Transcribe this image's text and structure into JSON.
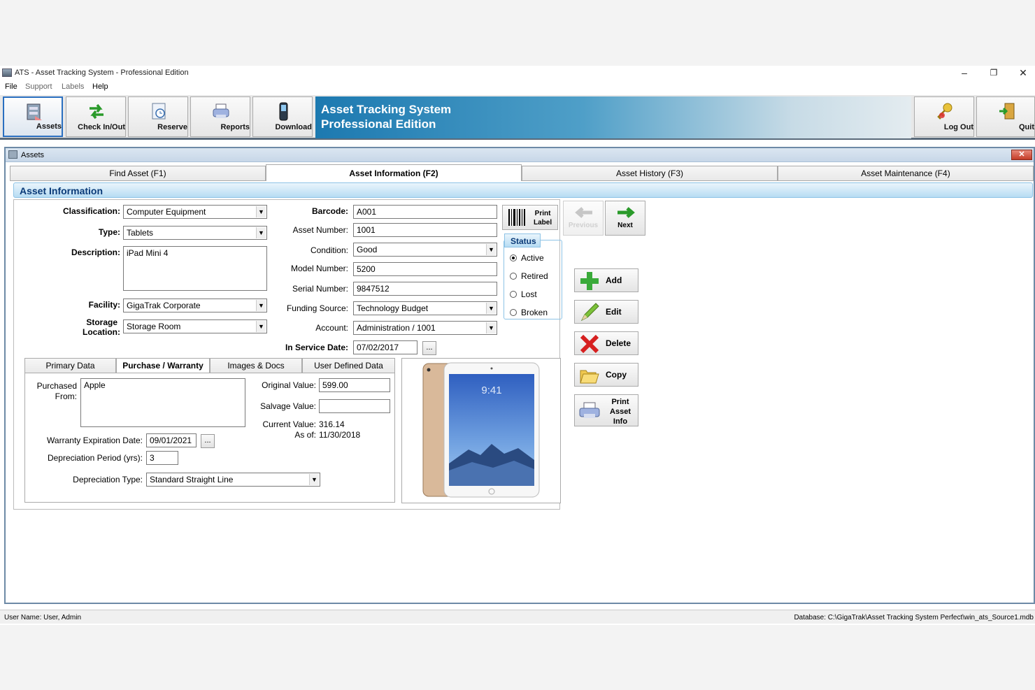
{
  "window": {
    "title": "ATS - Asset Tracking System - Professional Edition",
    "min": "–",
    "restore": "❐",
    "close": "✕"
  },
  "menu": [
    "File",
    "Support",
    "Labels",
    "Help"
  ],
  "toolbar": {
    "assets": "Assets",
    "checkinout": "Check In/Out",
    "reserve": "Reserve",
    "reports": "Reports",
    "download": "Download",
    "logout": "Log Out",
    "quit": "Quit"
  },
  "banner": {
    "line1": "Asset Tracking System",
    "line2": "Professional Edition"
  },
  "mdi": {
    "title": "Assets",
    "close": "✕"
  },
  "tabs": [
    "Find Asset (F1)",
    "Asset Information (F2)",
    "Asset History (F3)",
    "Asset Maintenance (F4)"
  ],
  "section": "Asset Information",
  "form": {
    "classification_label": "Classification:",
    "classification": "Computer Equipment",
    "type_label": "Type:",
    "type": "Tablets",
    "description_label": "Description:",
    "description": "iPad Mini 4",
    "facility_label": "Facility:",
    "facility": "GigaTrak Corporate",
    "storage_label_1": "Storage",
    "storage_label_2": "Location:",
    "storage": "Storage Room",
    "barcode_label": "Barcode:",
    "barcode": "A001",
    "asset_number_label": "Asset Number:",
    "asset_number": "1001",
    "condition_label": "Condition:",
    "condition": "Good",
    "model_label": "Model Number:",
    "model": "5200",
    "serial_label": "Serial Number:",
    "serial": "9847512",
    "funding_label": "Funding Source:",
    "funding": "Technology Budget",
    "account_label": "Account:",
    "account": "Administration / 1001",
    "inservice_label": "In Service Date:",
    "inservice": "07/02/2017",
    "dots": "..."
  },
  "print_label": {
    "l1": "Print",
    "l2": "Label"
  },
  "status": {
    "title": "Status",
    "options": [
      "Active",
      "Retired",
      "Lost",
      "Broken"
    ]
  },
  "nav": {
    "previous": "Previous",
    "next": "Next"
  },
  "actions": {
    "add": "Add",
    "edit": "Edit",
    "delete": "Delete",
    "copy": "Copy",
    "print1": "Print",
    "print2": "Asset",
    "print3": "Info"
  },
  "subtabs": [
    "Primary Data",
    "Purchase / Warranty",
    "Images & Docs",
    "User Defined Data"
  ],
  "purchase": {
    "from_label_1": "Purchased",
    "from_label_2": "From:",
    "from": "Apple",
    "original_label": "Original Value:",
    "original": "599.00",
    "salvage_label": "Salvage Value:",
    "salvage": "",
    "current_label": "Current Value:",
    "current": "316.14",
    "asof_label": "As of:",
    "asof": "11/30/2018",
    "warranty_label": "Warranty Expiration Date:",
    "warranty": "09/01/2021",
    "period_label": "Depreciation Period (yrs):",
    "period": "3",
    "deptype_label": "Depreciation Type:",
    "deptype": "Standard Straight Line"
  },
  "image": {
    "time": "9:41"
  },
  "statusbar": {
    "user": "User Name:  User, Admin",
    "db": "Database:  C:\\GigaTrak\\Asset Tracking System Perfect\\win_ats_Source1.mdb"
  }
}
